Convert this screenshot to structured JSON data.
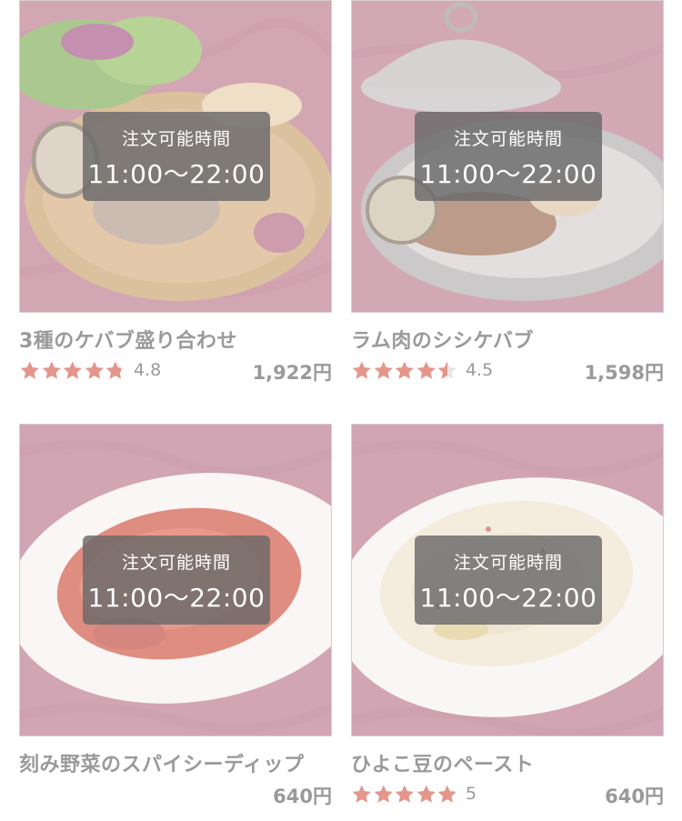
{
  "colors": {
    "star": "#e4968c",
    "star_empty": "#e8e3e3",
    "text": "#9a9a9a",
    "overlay": "#696969"
  },
  "items": [
    {
      "name": "3種のケバブ盛り合わせ",
      "hours_label": "注文可能時間",
      "hours": "11:00〜22:00",
      "rating": 4.8,
      "rating_label": "4.8",
      "price": "1,922円"
    },
    {
      "name": "ラム肉のシシケバブ",
      "hours_label": "注文可能時間",
      "hours": "11:00〜22:00",
      "rating": 4.5,
      "rating_label": "4.5",
      "price": "1,598円"
    },
    {
      "name": "刻み野菜のスパイシーディップ",
      "hours_label": "注文可能時間",
      "hours": "11:00〜22:00",
      "rating": null,
      "rating_label": "",
      "price": "640円"
    },
    {
      "name": "ひよこ豆のペースト",
      "hours_label": "注文可能時間",
      "hours": "11:00〜22:00",
      "rating": 5,
      "rating_label": "5",
      "price": "640円"
    }
  ]
}
